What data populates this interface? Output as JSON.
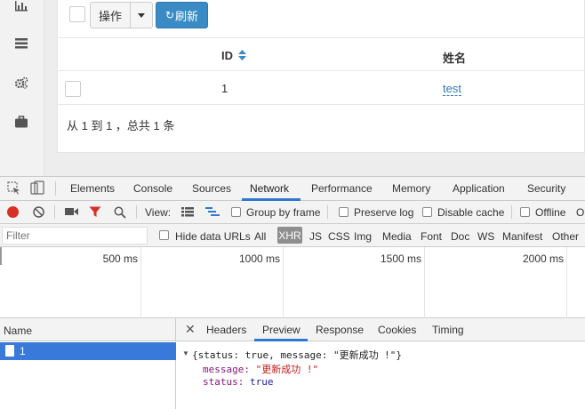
{
  "app": {
    "toolbar": {
      "ops_label": "操作",
      "refresh_label": "刷新"
    },
    "table": {
      "columns": [
        "ID",
        "姓名"
      ],
      "rows": [
        {
          "id": "1",
          "name": "test"
        }
      ],
      "pagination": "从 1 到 1 ，总共 1 条"
    },
    "sidebar_icons": [
      "bar-chart-icon",
      "list-icon",
      "cogs-icon",
      "briefcase-icon"
    ]
  },
  "devtools": {
    "tabs": [
      "Elements",
      "Console",
      "Sources",
      "Network",
      "Performance",
      "Memory",
      "Application",
      "Security"
    ],
    "active_tab": "Network",
    "toolbar": {
      "view_label": "View:",
      "group_by_frame": "Group by frame",
      "preserve_log": "Preserve log",
      "disable_cache": "Disable cache",
      "offline": "Offline",
      "online_truncated": "O"
    },
    "filter": {
      "placeholder": "Filter",
      "hide_data_urls": "Hide data URLs",
      "types": [
        "All",
        "XHR",
        "JS",
        "CSS",
        "Img",
        "Media",
        "Font",
        "Doc",
        "WS",
        "Manifest",
        "Other"
      ],
      "selected_type": "XHR"
    },
    "timeline": {
      "ticks": [
        "500 ms",
        "1000 ms",
        "1500 ms",
        "2000 ms"
      ]
    },
    "request_list": {
      "header": "Name",
      "items": [
        "1"
      ]
    },
    "detail": {
      "tabs": [
        "Headers",
        "Preview",
        "Response",
        "Cookies",
        "Timing"
      ],
      "active_tab": "Preview",
      "preview": {
        "summary": "{status: true, message: \"更新成功 !\"}",
        "fields": [
          {
            "key": "message",
            "value": "\"更新成功 !\""
          },
          {
            "key": "status",
            "value": "true"
          }
        ]
      }
    },
    "colors": {
      "accent": "#2f78d1",
      "record": "#d93025",
      "filter_red": "#d93025",
      "selected_row": "#3879d9"
    }
  }
}
